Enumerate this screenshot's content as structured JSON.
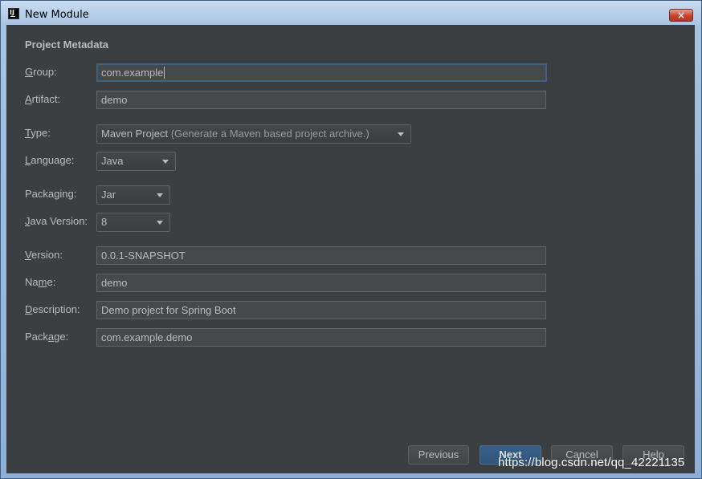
{
  "window": {
    "title": "New Module",
    "close_glyph": "×",
    "app_icon_text": "IJ"
  },
  "section": {
    "title": "Project Metadata"
  },
  "fields": {
    "group": {
      "label_prefix": "",
      "label_mnemonic": "G",
      "label_suffix": "roup:",
      "value": "com.example"
    },
    "artifact": {
      "label_prefix": "",
      "label_mnemonic": "A",
      "label_suffix": "rtifact:",
      "value": "demo"
    },
    "type": {
      "label_prefix": "",
      "label_mnemonic": "T",
      "label_suffix": "ype:",
      "value": "Maven Project",
      "hint": "(Generate a Maven based project archive.)"
    },
    "language": {
      "label_prefix": "",
      "label_mnemonic": "L",
      "label_suffix": "anguage:",
      "value": "Java"
    },
    "packaging": {
      "label_prefix": "Packa",
      "label_mnemonic": "g",
      "label_suffix": "ing:",
      "value": "Jar"
    },
    "java_version": {
      "label_prefix": "",
      "label_mnemonic": "J",
      "label_suffix": "ava Version:",
      "value": "8"
    },
    "version": {
      "label_prefix": "",
      "label_mnemonic": "V",
      "label_suffix": "ersion:",
      "value": "0.0.1-SNAPSHOT"
    },
    "name": {
      "label_prefix": "Na",
      "label_mnemonic": "m",
      "label_suffix": "e:",
      "value": "demo"
    },
    "description": {
      "label_prefix": "",
      "label_mnemonic": "D",
      "label_suffix": "escription:",
      "value": "Demo project for Spring Boot"
    },
    "package": {
      "label_prefix": "Pack",
      "label_mnemonic": "a",
      "label_suffix": "ge:",
      "value": "com.example.demo"
    }
  },
  "buttons": {
    "previous": "Previous",
    "next": "Next",
    "cancel": "Cancel",
    "help": "Help"
  },
  "watermark": "https://blog.csdn.net/qq_42221135",
  "colors": {
    "background": "#3c3f41",
    "text": "#bbbbbb",
    "accent": "#365880",
    "focus_border": "#3d6185"
  }
}
